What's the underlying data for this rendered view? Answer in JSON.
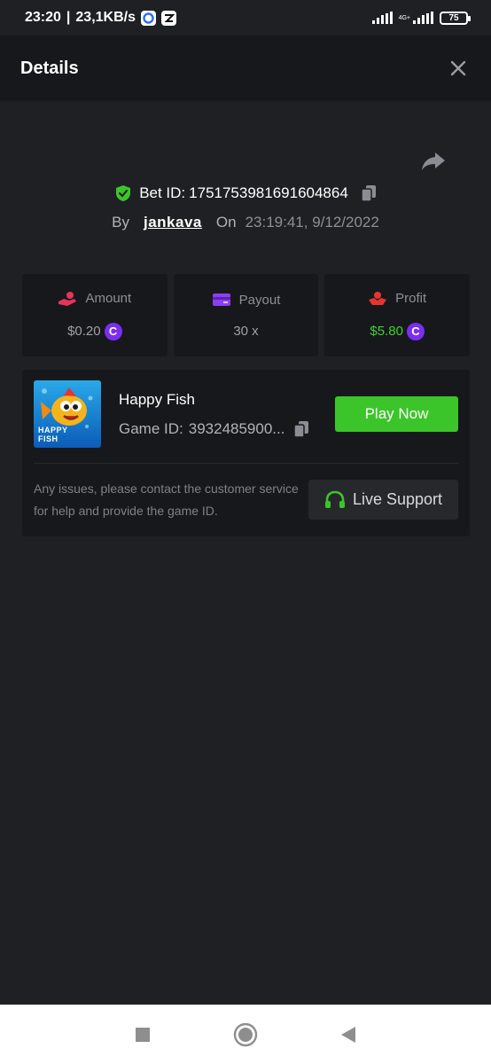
{
  "status_bar": {
    "time": "23:20",
    "speed": "23,1KB/s",
    "network": "4G+",
    "battery": "75"
  },
  "header": {
    "title": "Details"
  },
  "bet": {
    "bet_id_label": "Bet ID:",
    "bet_id": "1751753981691604864",
    "by_label": "By",
    "username": "jankava",
    "on_label": "On",
    "datetime": "23:19:41, 9/12/2022"
  },
  "stats": {
    "amount_label": "Amount",
    "amount_value": "$0.20",
    "payout_label": "Payout",
    "payout_value": "30 x",
    "profit_label": "Profit",
    "profit_value": "$5.80",
    "coin_glyph": "C"
  },
  "game": {
    "name": "Happy Fish",
    "id_label": "Game ID:",
    "id_value": "3932485900...",
    "thumb_text_1": "HAPPY",
    "thumb_text_2": "FISH",
    "play_label": "Play Now",
    "issues_text": "Any issues, please contact the customer service for help and provide the game ID.",
    "support_label": "Live Support"
  },
  "colors": {
    "background": "#1e2023",
    "panel": "#17181b",
    "accent_green": "#3cc52a",
    "profit_green": "#3dd22c",
    "coin_purple": "#7b2ef0"
  },
  "icons": {
    "close": "close-icon",
    "share": "share-icon",
    "shield": "shield-check-icon",
    "copy": "copy-icon",
    "amount": "hand-coin-icon",
    "payout": "card-icon",
    "profit": "hand-heart-icon",
    "support": "headset-icon"
  }
}
